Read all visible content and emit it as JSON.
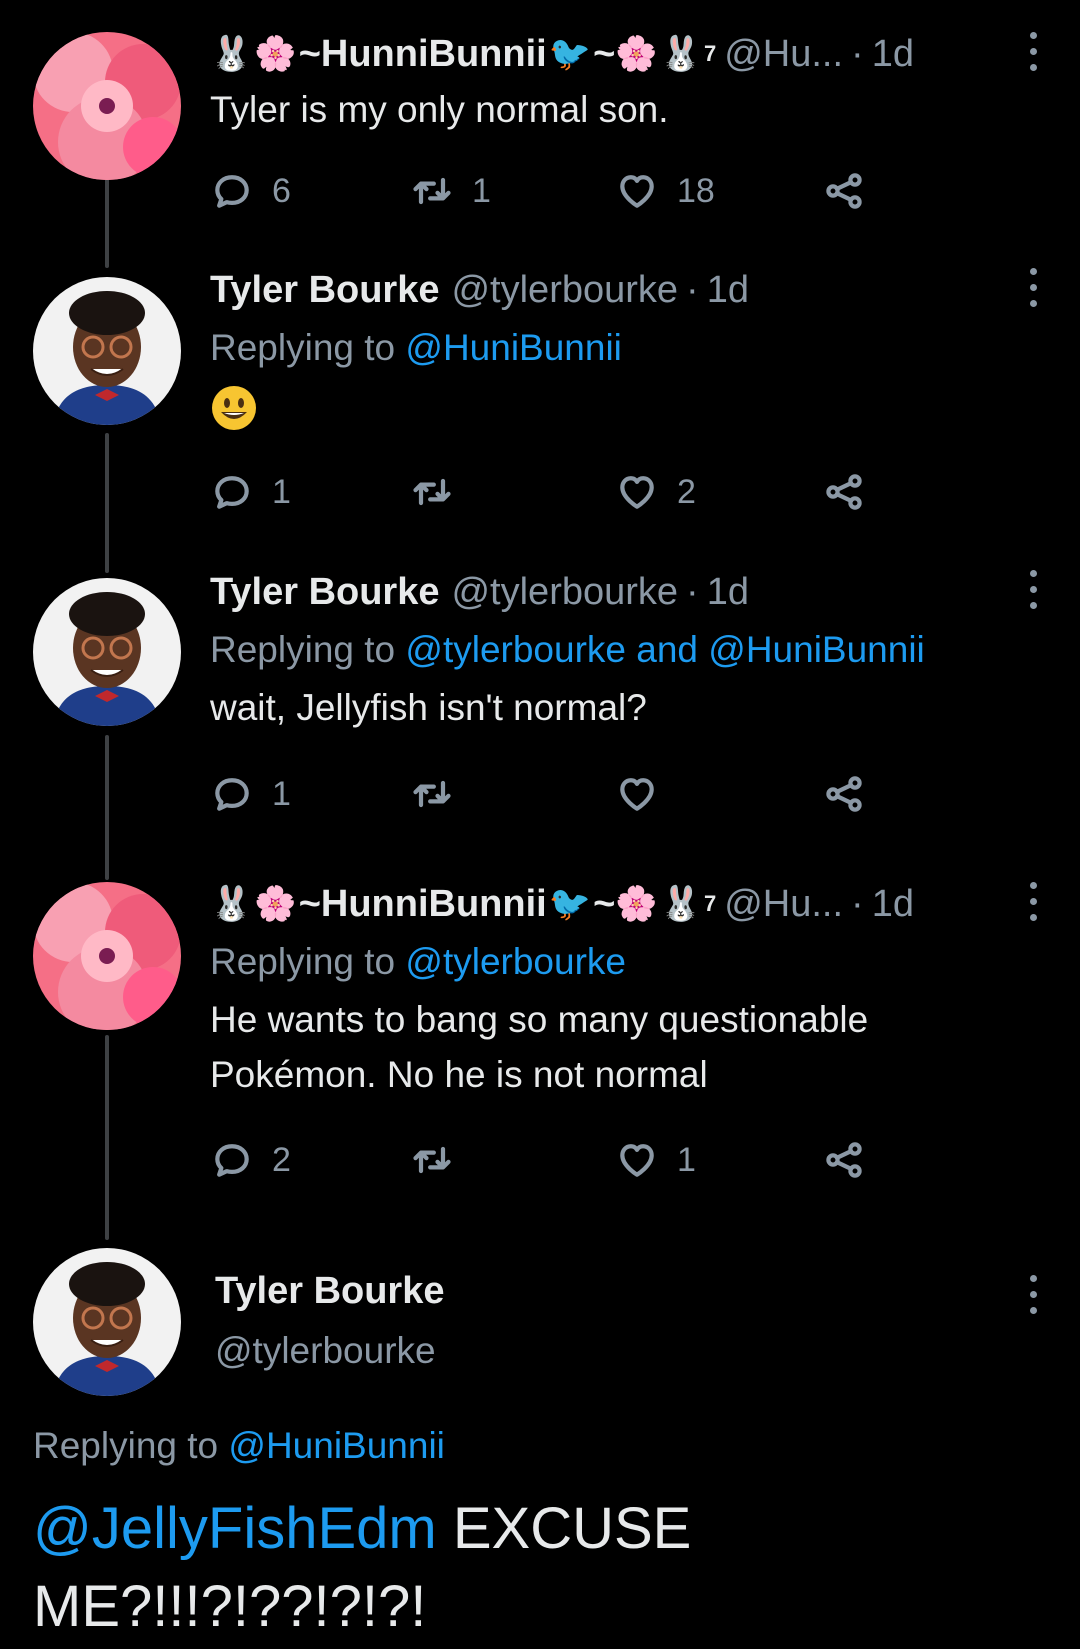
{
  "tweets": [
    {
      "name": "~HunniBunnii",
      "suffix": "~",
      "sup": "7",
      "handle": "@Hu...",
      "time": "1d",
      "text": "Tyler is my only normal son.",
      "replies": "6",
      "retweets": "1",
      "likes": "18"
    },
    {
      "name": "Tyler Bourke",
      "handle": "@tylerbourke",
      "time": "1d",
      "replying_label": "Replying to",
      "replying_to": "@HuniBunnii",
      "emoji": "smiling-face",
      "replies": "1",
      "retweets": "",
      "likes": "2"
    },
    {
      "name": "Tyler Bourke",
      "handle": "@tylerbourke",
      "time": "1d",
      "replying_label": "Replying to",
      "replying_to": "@tylerbourke and @HuniBunnii",
      "text": "wait, Jellyfish isn't normal?",
      "replies": "1",
      "retweets": "",
      "likes": ""
    },
    {
      "name": "~HunniBunnii",
      "suffix": "~",
      "sup": "7",
      "handle": "@Hu...",
      "time": "1d",
      "replying_label": "Replying to",
      "replying_to": "@tylerbourke",
      "text_line1": "He wants to bang so many questionable",
      "text_line2": "Pokémon. No he is not normal",
      "replies": "2",
      "retweets": "",
      "likes": "1"
    }
  ],
  "main_tweet": {
    "name": "Tyler Bourke",
    "handle": "@tylerbourke",
    "replying_label": "Replying to",
    "replying_to": "@HuniBunnii",
    "mention": "@JellyFishEdm",
    "text_after_mention": " EXCUSE",
    "text_line2": "ME?!!!?!??!?!?!"
  },
  "decorations": {
    "rabbit_emoji": "🐰",
    "flower_emoji": "🌸",
    "bird_glyph": "🐦"
  },
  "colors": {
    "link": "#1d9bf0",
    "muted": "#8b98a5",
    "text": "#e7e9ea",
    "background": "#000000"
  }
}
